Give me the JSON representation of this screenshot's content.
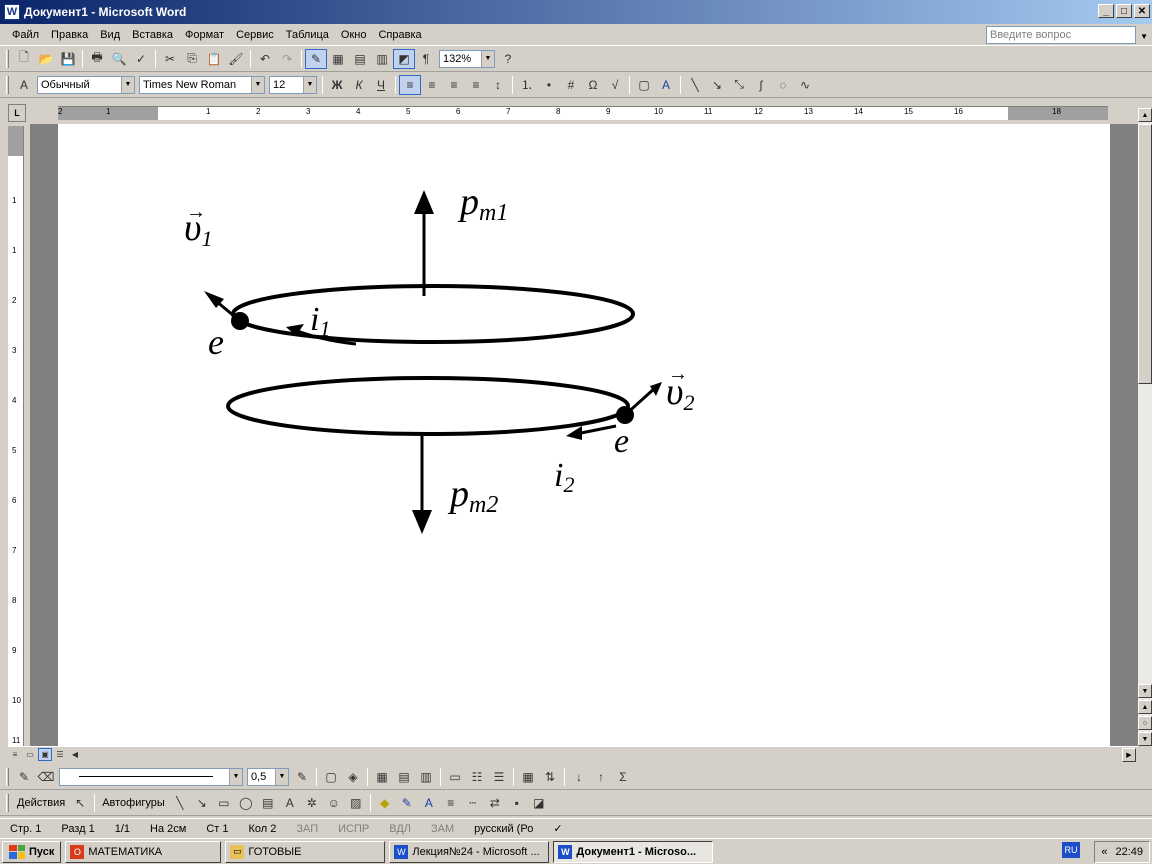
{
  "window": {
    "title": "Документ1 - Microsoft Word",
    "app_icon": "word-icon"
  },
  "menu": {
    "items": [
      "Файл",
      "Правка",
      "Вид",
      "Вставка",
      "Формат",
      "Сервис",
      "Таблица",
      "Окно",
      "Справка"
    ],
    "ask_placeholder": "Введите вопрос"
  },
  "standard_toolbar": {
    "zoom": "132%"
  },
  "formatting_toolbar": {
    "style": "Обычный",
    "font": "Times New Roman",
    "size": "12",
    "bold": "Ж",
    "italic": "К",
    "underline": "Ч"
  },
  "ruler": {
    "h_numbers": [
      "2",
      "1",
      "1",
      "2",
      "3",
      "4",
      "5",
      "6",
      "7",
      "8",
      "9",
      "10",
      "11",
      "12",
      "13",
      "14",
      "15",
      "16",
      "18"
    ],
    "v_numbers": [
      "1",
      "1",
      "2",
      "3",
      "4",
      "5",
      "6",
      "7",
      "8",
      "9",
      "10",
      "11"
    ]
  },
  "figure": {
    "v1": "υ",
    "v1_sub": "1",
    "v2": "υ",
    "v2_sub": "2",
    "pm1": "p",
    "pm1_sub": "m1",
    "pm2": "p",
    "pm2_sub": "m2",
    "i1": "i",
    "i1_sub": "1",
    "i2": "i",
    "i2_sub": "2",
    "e_top": "e",
    "e_bottom": "e"
  },
  "drawing_toolbar": {
    "line_weight": "0,5",
    "actions": "Действия",
    "autoshapes": "Автофигуры"
  },
  "status": {
    "page": "Стр. 1",
    "section": "Разд 1",
    "pages": "1/1",
    "at": "На 2см",
    "line": "Ст 1",
    "col": "Кол 2",
    "rec": "ЗАП",
    "trk": "ИСПР",
    "ext": "ВДЛ",
    "ovr": "ЗАМ",
    "lang": "русский (Ро"
  },
  "taskbar": {
    "start": "Пуск",
    "items": [
      "МАТЕМАТИКА",
      "ГОТОВЫЕ",
      "Лекция№24 - Microsoft ...",
      "Документ1 - Microso..."
    ],
    "lang": "RU",
    "time": "22:49"
  }
}
